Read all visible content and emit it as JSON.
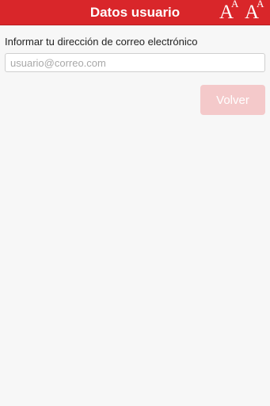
{
  "header": {
    "title": "Datos usuario",
    "font_increase": {
      "big": "A",
      "small": "A",
      "icon": "font-size-increase-icon"
    },
    "font_decrease": {
      "big": "A",
      "small": "A",
      "icon": "font-size-decrease-icon"
    }
  },
  "form": {
    "email_label": "Informar tu dirección de correo electrónico",
    "email_value": "",
    "email_placeholder": "usuario@correo.com",
    "back_label": "Volver"
  },
  "colors": {
    "app_bar": "#d9262a",
    "background": "#f7f7f7",
    "button_disabled": "#f4c9ca"
  }
}
